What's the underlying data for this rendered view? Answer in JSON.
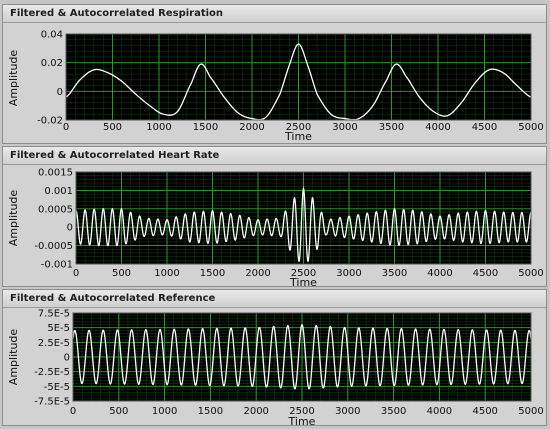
{
  "charts": [
    {
      "title": "Filtered & Autocorrelated Respiration",
      "xlabel": "Time",
      "ylabel": "Amplitude",
      "x_ticks": [
        "0",
        "500",
        "1000",
        "1500",
        "2000",
        "2500",
        "3000",
        "3500",
        "4000",
        "4500",
        "5000"
      ],
      "y_ticks": [
        {
          "v": 0.04,
          "label": "0.04"
        },
        {
          "v": 0.02,
          "label": "0.02"
        },
        {
          "v": 0,
          "label": "0"
        },
        {
          "v": -0.02,
          "label": "-0.02"
        }
      ],
      "ylim": [
        -0.02,
        0.04
      ],
      "xlim": [
        0,
        5000
      ]
    },
    {
      "title": "Filtered & Autocorrelated Heart Rate",
      "xlabel": "Time",
      "ylabel": "Amplitude",
      "x_ticks": [
        "0",
        "500",
        "1000",
        "1500",
        "2000",
        "2500",
        "3000",
        "3500",
        "4000",
        "4500",
        "5000"
      ],
      "y_ticks": [
        {
          "v": 0.0015,
          "label": "0.0015"
        },
        {
          "v": 0.001,
          "label": "0.001"
        },
        {
          "v": 0.0005,
          "label": "0.0005"
        },
        {
          "v": 0,
          "label": "0"
        },
        {
          "v": -0.0005,
          "label": "-0.0005"
        },
        {
          "v": -0.001,
          "label": "-0.001"
        }
      ],
      "ylim": [
        -0.001,
        0.0015
      ],
      "xlim": [
        0,
        5000
      ]
    },
    {
      "title": "Filtered & Autocorrelated Reference",
      "xlabel": "Time",
      "ylabel": "Amplitude",
      "x_ticks": [
        "0",
        "500",
        "1000",
        "1500",
        "2000",
        "2500",
        "3000",
        "3500",
        "4000",
        "4500",
        "5000"
      ],
      "y_ticks": [
        {
          "v": 7.5e-05,
          "label": "7.5E-5"
        },
        {
          "v": 5e-05,
          "label": "5E-5"
        },
        {
          "v": 2.5e-05,
          "label": "2.5E-5"
        },
        {
          "v": 0,
          "label": "0"
        },
        {
          "v": -2.5e-05,
          "label": "-2.5E-5"
        },
        {
          "v": -5e-05,
          "label": "-5E-5"
        },
        {
          "v": -7.5e-05,
          "label": "-7.5E-5"
        }
      ],
      "ylim": [
        -7.5e-05,
        7.5e-05
      ],
      "xlim": [
        0,
        5000
      ]
    }
  ],
  "colors": {
    "plot_bg": "#000000",
    "grid": "#1f7a1f",
    "trace": "#ffffff"
  },
  "chart_data": [
    {
      "type": "line",
      "title": "Filtered & Autocorrelated Respiration",
      "xlabel": "Time",
      "ylabel": "Amplitude",
      "xlim": [
        0,
        5000
      ],
      "ylim": [
        -0.02,
        0.04
      ],
      "grid": true,
      "series": [
        {
          "x": [
            0,
            150,
            300,
            450,
            600,
            750,
            900,
            1050,
            1200,
            1350,
            1450,
            1550,
            1700,
            1850,
            2000,
            2150,
            2300,
            2400,
            2500,
            2600,
            2700,
            2850,
            3000,
            3150,
            3300,
            3450,
            3550,
            3650,
            3800,
            3950,
            4100,
            4250,
            4400,
            4550,
            4700,
            4850,
            5000
          ],
          "y": [
            -0.004,
            0.008,
            0.015,
            0.013,
            0.007,
            -0.002,
            -0.01,
            -0.016,
            -0.014,
            0.006,
            0.019,
            0.01,
            -0.004,
            -0.015,
            -0.019,
            -0.018,
            -0.002,
            0.018,
            0.033,
            0.018,
            -0.002,
            -0.016,
            -0.019,
            -0.019,
            -0.01,
            0.008,
            0.019,
            0.011,
            -0.004,
            -0.014,
            -0.017,
            -0.008,
            0.006,
            0.015,
            0.013,
            0.004,
            -0.004
          ]
        }
      ]
    },
    {
      "type": "line",
      "title": "Filtered & Autocorrelated Heart Rate",
      "xlabel": "Time",
      "ylabel": "Amplitude",
      "xlim": [
        0,
        5000
      ],
      "ylim": [
        -0.001,
        0.0015
      ],
      "grid": true,
      "series": [
        {
          "description_period": 100,
          "x": [
            0,
            250,
            500,
            750,
            1000,
            1250,
            1500,
            1750,
            2000,
            2250,
            2400,
            2500,
            2600,
            2750,
            3000,
            3250,
            3500,
            3750,
            4000,
            4250,
            4500,
            4750,
            5000
          ],
          "amplitude": [
            0.00045,
            0.0005,
            0.0005,
            0.00025,
            0.0002,
            0.0004,
            0.00045,
            0.00035,
            0.0002,
            0.00025,
            0.0008,
            0.00105,
            0.0008,
            0.0002,
            0.0003,
            0.0004,
            0.0005,
            0.00045,
            0.0003,
            0.0004,
            0.00045,
            0.0004,
            0.0004
          ]
        }
      ]
    },
    {
      "type": "line",
      "title": "Filtered & Autocorrelated Reference",
      "xlabel": "Time",
      "ylabel": "Amplitude",
      "xlim": [
        0,
        5000
      ],
      "ylim": [
        -7.5e-05,
        7.5e-05
      ],
      "grid": true,
      "series": [
        {
          "description_period": 155,
          "x": [
            0,
            1000,
            2000,
            2500,
            3000,
            4000,
            5000
          ],
          "amplitude": [
            4.5e-05,
            4.7e-05,
            5e-05,
            5.5e-05,
            5e-05,
            4.7e-05,
            4.5e-05
          ]
        }
      ]
    }
  ]
}
